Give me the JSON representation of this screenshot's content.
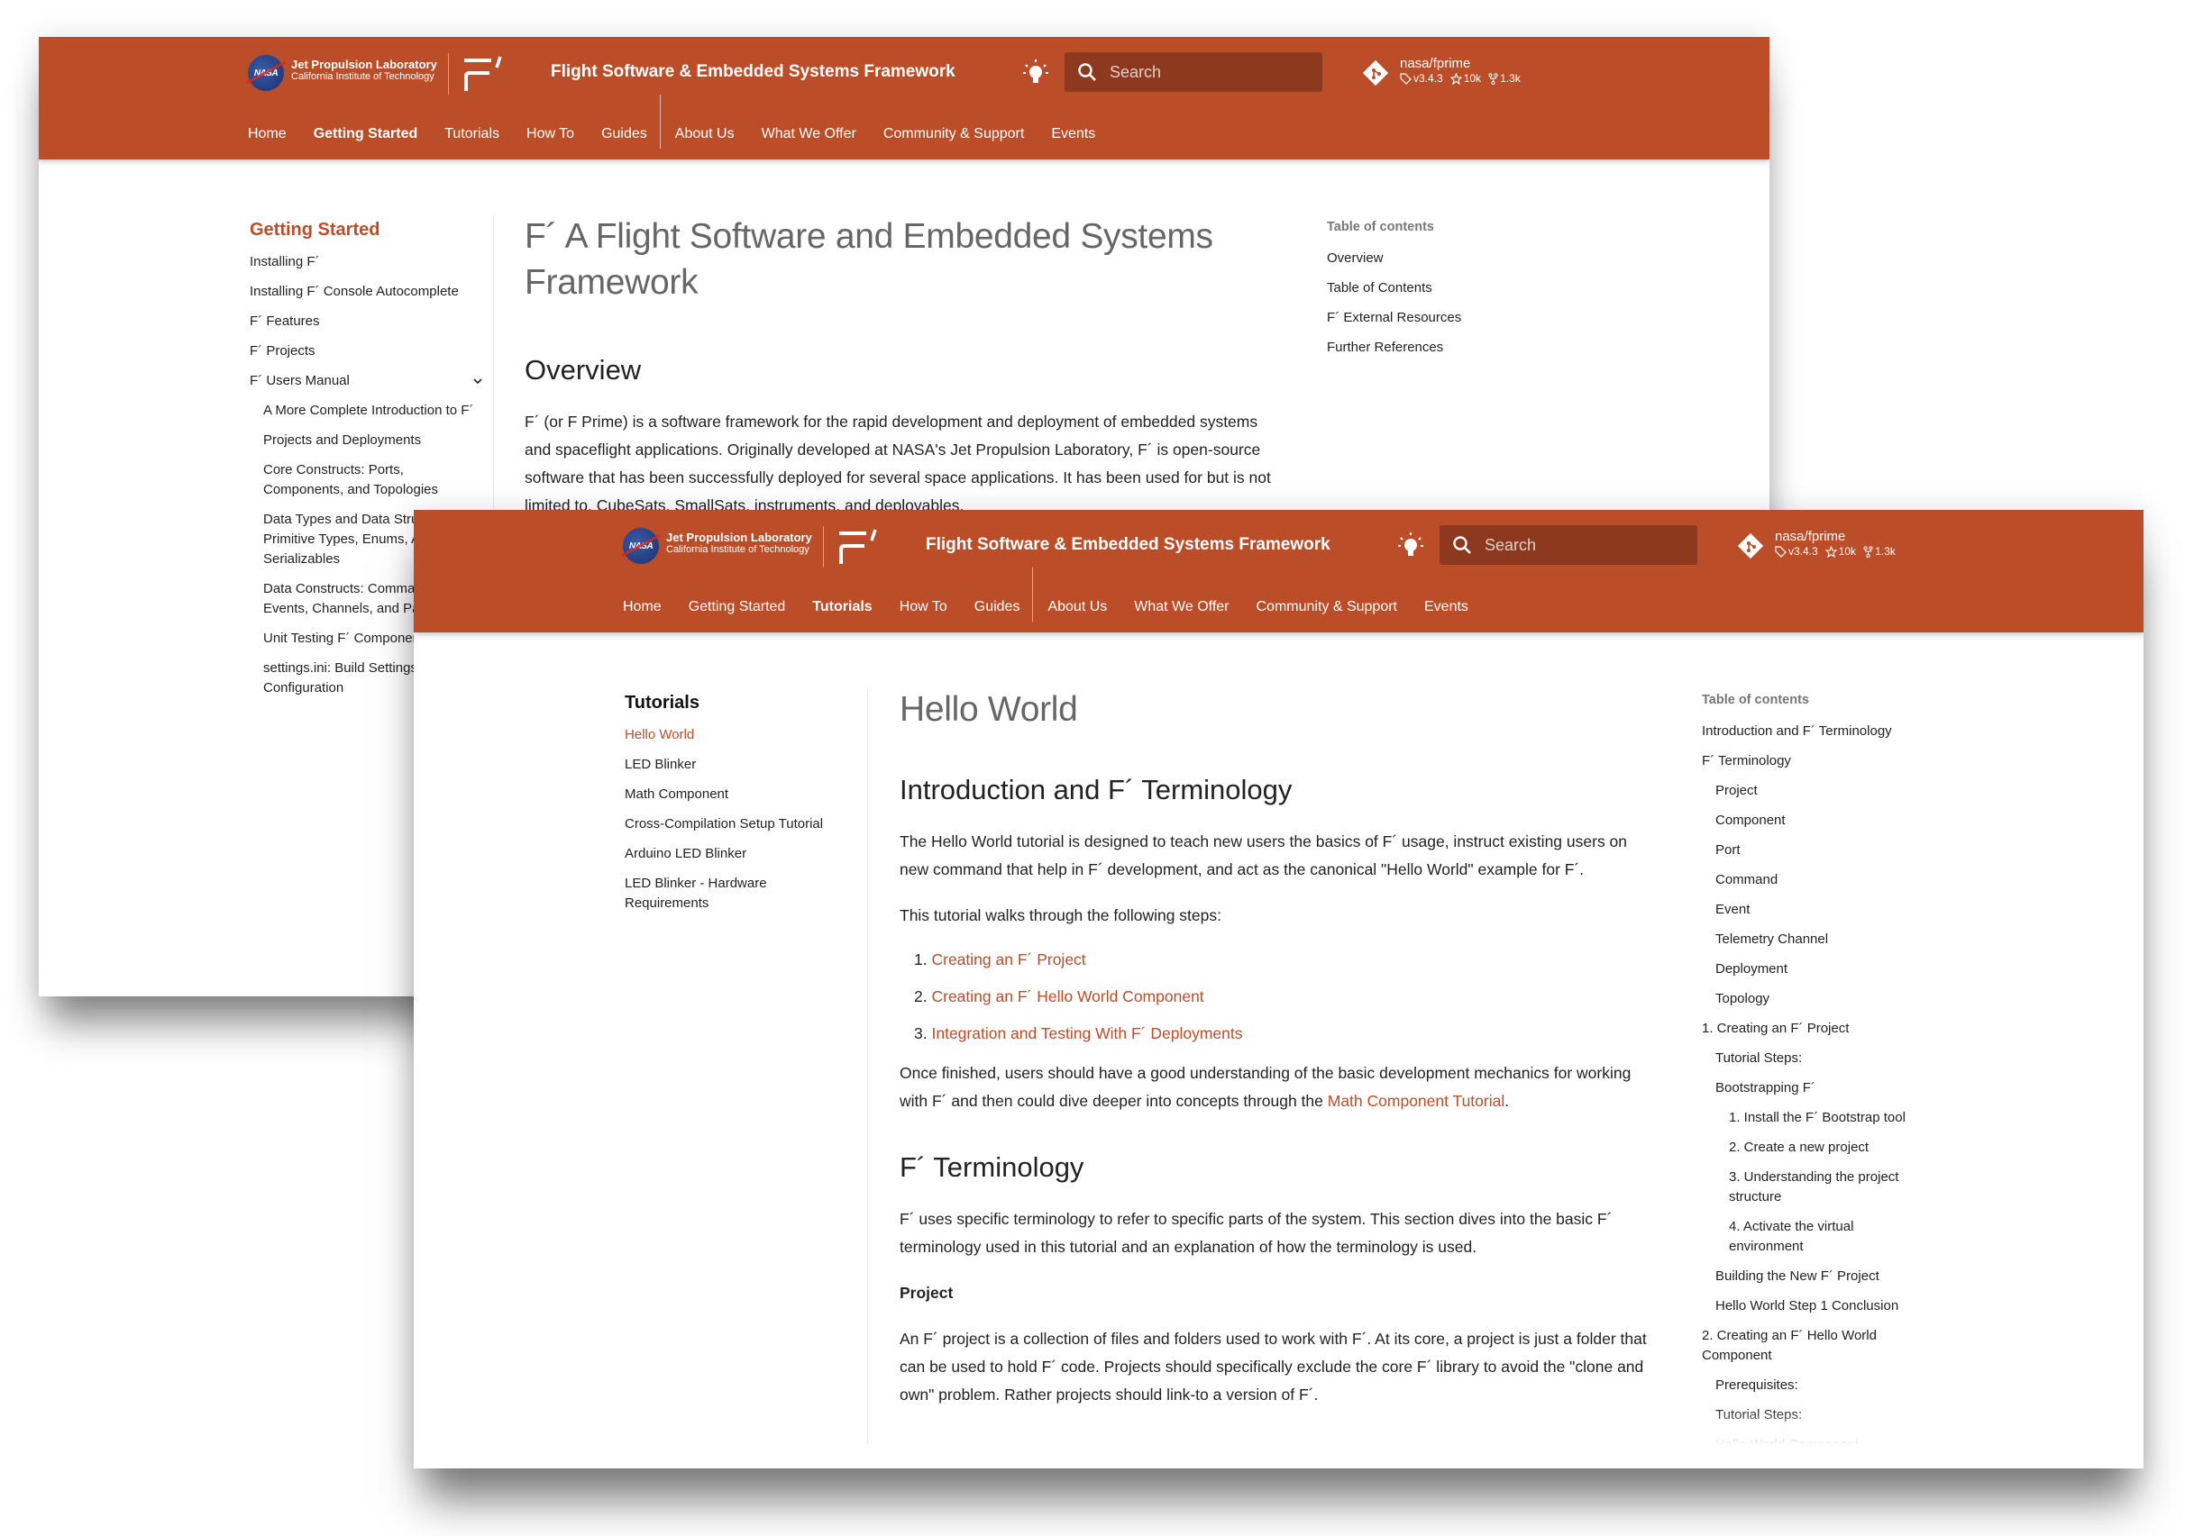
{
  "brand": {
    "nasa_badge": "NASA",
    "jpl_line1": "Jet Propulsion Laboratory",
    "jpl_line2": "California Institute of Technology",
    "site_title": "Flight Software & Embedded Systems Framework",
    "accent_color": "#bb4e28",
    "search_bg_color": "#8c3920"
  },
  "search": {
    "placeholder": "Search"
  },
  "repo": {
    "name": "nasa/fprime",
    "version": "v3.4.3",
    "stars": "10k",
    "forks": "1.3k"
  },
  "nav": [
    {
      "label": "Home"
    },
    {
      "label": "Getting Started"
    },
    {
      "label": "Tutorials"
    },
    {
      "label": "How To"
    },
    {
      "label": "Guides"
    },
    {
      "label": "About Us"
    },
    {
      "label": "What We Offer"
    },
    {
      "label": "Community & Support"
    },
    {
      "label": "Events"
    }
  ],
  "back_window": {
    "active_nav": "Getting Started",
    "sidebar": {
      "title": "Getting Started",
      "items": [
        {
          "label": "Installing F´"
        },
        {
          "label": "Installing F´ Console Autocomplete"
        },
        {
          "label": "F´ Features"
        },
        {
          "label": "F´ Projects"
        },
        {
          "label": "F´ Users Manual",
          "expanded": true
        },
        {
          "label": "A More Complete Introduction to F´"
        },
        {
          "label": "Projects and Deployments"
        },
        {
          "label": "Core Constructs: Ports, Components, and Topologies"
        },
        {
          "label": "Data Types and Data Structures: Primitive Types, Enums, Arrays, and Serializables"
        },
        {
          "label": "Data Constructs: Commands, Events, Channels, and Parameters"
        },
        {
          "label": "Unit Testing F´ Components"
        },
        {
          "label": "settings.ini: Build Settings Configuration"
        }
      ]
    },
    "main": {
      "title": "F´ A Flight Software and Embedded Systems Framework",
      "section": "Overview",
      "paragraph": "F´ (or F Prime) is a software framework for the rapid development and deployment of embedded systems and spaceflight applications. Originally developed at NASA's Jet Propulsion Laboratory, F´ is open-source software that has been successfully deployed for several space applications. It has been used for but is not limited to, CubeSats, SmallSats, instruments, and deployables."
    },
    "toc": {
      "title": "Table of contents",
      "items": [
        {
          "label": "Overview"
        },
        {
          "label": "Table of Contents"
        },
        {
          "label": "F´ External Resources"
        },
        {
          "label": "Further References"
        }
      ]
    }
  },
  "front_window": {
    "active_nav": "Tutorials",
    "sidebar": {
      "title": "Tutorials",
      "items": [
        {
          "label": "Hello World",
          "active": true
        },
        {
          "label": "LED Blinker"
        },
        {
          "label": "Math Component"
        },
        {
          "label": "Cross-Compilation Setup Tutorial"
        },
        {
          "label": "Arduino LED Blinker"
        },
        {
          "label": "LED Blinker - Hardware Requirements"
        }
      ]
    },
    "main": {
      "title": "Hello World",
      "section1": "Introduction and F´ Terminology",
      "intro": "The Hello World tutorial is designed to teach new users the basics of F´ usage, instruct existing users on new command that help in F´ development, and act as the canonical \"Hello World\" example for F´.",
      "steps_intro": "This tutorial walks through the following steps:",
      "steps": [
        {
          "num": "1.",
          "label": "Creating an F´ Project"
        },
        {
          "num": "2.",
          "label": "Creating an F´ Hello World Component"
        },
        {
          "num": "3.",
          "label": "Integration and Testing With F´ Deployments"
        }
      ],
      "finish_prefix": "Once finished, users should have a good understanding of the basic development mechanics for working with F´ and then could dive deeper into concepts through the ",
      "finish_link": "Math Component Tutorial",
      "finish_suffix": ".",
      "section2": "F´ Terminology",
      "terminology": "F´ uses specific terminology to refer to specific parts of the system. This section dives into the basic F´ terminology used in this tutorial and an explanation of how the terminology is used.",
      "project_heading": "Project",
      "project_text": "An F´ project is a collection of files and folders used to work with F´. At its core, a project is just a folder that can be used to hold F´ code. Projects should specifically exclude the core F´ library to avoid the \"clone and own\" problem. Rather projects should link-to a version of F´."
    },
    "toc": {
      "title": "Table of contents",
      "items": [
        {
          "label": "Introduction and F´ Terminology",
          "level": 1
        },
        {
          "label": "F´ Terminology",
          "level": 1
        },
        {
          "label": "Project",
          "level": 2
        },
        {
          "label": "Component",
          "level": 2
        },
        {
          "label": "Port",
          "level": 2
        },
        {
          "label": "Command",
          "level": 2
        },
        {
          "label": "Event",
          "level": 2
        },
        {
          "label": "Telemetry Channel",
          "level": 2
        },
        {
          "label": "Deployment",
          "level": 2
        },
        {
          "label": "Topology",
          "level": 2
        },
        {
          "label": "1. Creating an F´ Project",
          "level": 1
        },
        {
          "label": "Tutorial Steps:",
          "level": 2
        },
        {
          "label": "Bootstrapping F´",
          "level": 2
        },
        {
          "label": "1. Install the F´ Bootstrap tool",
          "level": 3
        },
        {
          "label": "2. Create a new project",
          "level": 3
        },
        {
          "label": "3. Understanding the project structure",
          "level": 3
        },
        {
          "label": "4. Activate the virtual environment",
          "level": 3
        },
        {
          "label": "Building the New F´ Project",
          "level": 2
        },
        {
          "label": "Hello World Step 1 Conclusion",
          "level": 2
        },
        {
          "label": "2. Creating an F´ Hello World Component",
          "level": 1
        },
        {
          "label": "Prerequisites:",
          "level": 2
        },
        {
          "label": "Tutorial Steps:",
          "level": 2
        },
        {
          "label": "Hello World Component",
          "level": 2
        }
      ]
    }
  }
}
